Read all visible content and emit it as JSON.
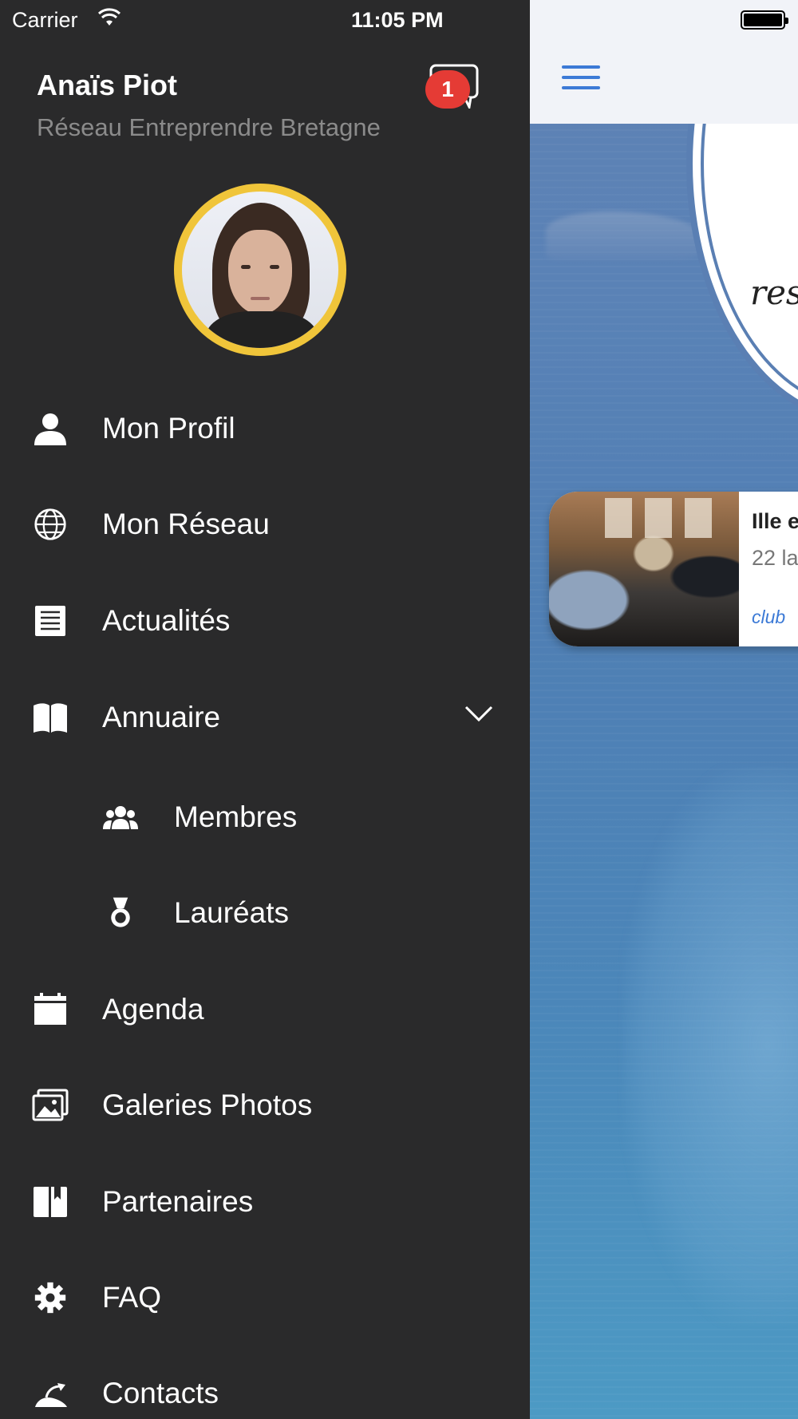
{
  "status_bar": {
    "carrier": "Carrier",
    "time": "11:05 PM"
  },
  "user": {
    "name": "Anaïs Piot",
    "organization": "Réseau Entreprendre Bretagne",
    "unread_messages": "1"
  },
  "menu": {
    "items": [
      {
        "label": "Mon Profil",
        "icon": "person-icon"
      },
      {
        "label": "Mon Réseau",
        "icon": "globe-icon"
      },
      {
        "label": "Actualités",
        "icon": "newspaper-icon"
      },
      {
        "label": "Annuaire",
        "icon": "book-icon",
        "expanded": true
      },
      {
        "label": "Membres",
        "icon": "group-icon",
        "sub": true
      },
      {
        "label": "Lauréats",
        "icon": "medal-icon",
        "sub": true
      },
      {
        "label": "Agenda",
        "icon": "calendar-icon"
      },
      {
        "label": "Galeries Photos",
        "icon": "photos-icon"
      },
      {
        "label": "Partenaires",
        "icon": "bookmark-book-icon"
      },
      {
        "label": "FAQ",
        "icon": "gear-icon"
      },
      {
        "label": "Contacts",
        "icon": "contacts-icon"
      }
    ]
  },
  "main": {
    "logo_text": "res",
    "card": {
      "title": "Ille e",
      "date": "22 la",
      "tag": "club"
    }
  },
  "colors": {
    "drawer_bg": "#2a2a2b",
    "accent_blue": "#3c7ad6",
    "badge_red": "#e53b35",
    "avatar_ring": "#f0c53a"
  }
}
